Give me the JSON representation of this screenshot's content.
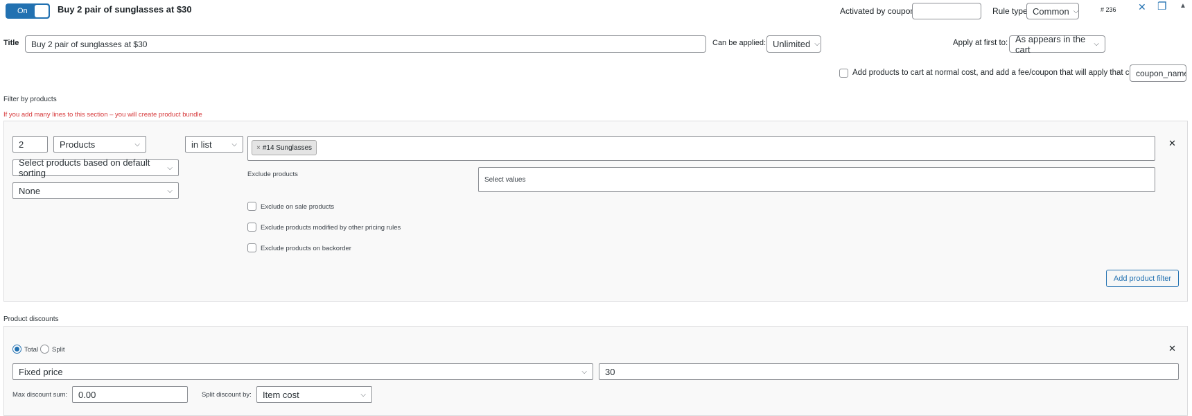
{
  "header": {
    "toggle_label": "On",
    "rule_title": "Buy 2 pair of sunglasses at $30",
    "activated_by_coupon_label": "Activated by coupon",
    "activated_by_coupon_value": "",
    "rule_type_label": "Rule type",
    "rule_type_value": "Common",
    "rule_id": "# 236",
    "accent_color": "#2271b1"
  },
  "title_row": {
    "title_label": "Title",
    "title_value": "Buy 2 pair of sunglasses at $30",
    "can_be_applied_label": "Can be applied:",
    "can_be_applied_value": "Unlimited",
    "apply_first_label": "Apply at first to:",
    "apply_first_value": "As appears in the cart"
  },
  "fee_option": {
    "label": "Add products to cart at normal cost, and add a fee/coupon that will apply that cost",
    "coupon_value": "coupon_name"
  },
  "filter_section": {
    "heading": "Filter by products",
    "warning": "If you add many lines to this section – you will create product bundle",
    "warning_color": "#d63638",
    "qty_value": "2",
    "type_value": "Products",
    "sorting_value": "Select products based on default sorting",
    "none_value": "None",
    "condition_value": "in list",
    "tag_label": "#14 Sunglasses",
    "tag_remove": "×",
    "exclude_label": "Exclude products",
    "exclude_placeholder": "Select values",
    "checkboxes": [
      "Exclude on sale products",
      "Exclude products modified by other pricing rules",
      "Exclude products on backorder"
    ],
    "add_filter_label": "Add product filter"
  },
  "discount_section": {
    "heading": "Product discounts",
    "radio_total": "Total",
    "radio_split": "Split",
    "method_value": "Fixed price",
    "amount_value": "30",
    "max_discount_label": "Max discount sum:",
    "max_discount_value": "0.00",
    "split_by_label": "Split discount by:",
    "split_by_value": "Item cost"
  },
  "icons": {
    "close": "✕",
    "copy": "❐",
    "collapse": "▲",
    "remove_row": "✕",
    "chevron": "⌵"
  }
}
